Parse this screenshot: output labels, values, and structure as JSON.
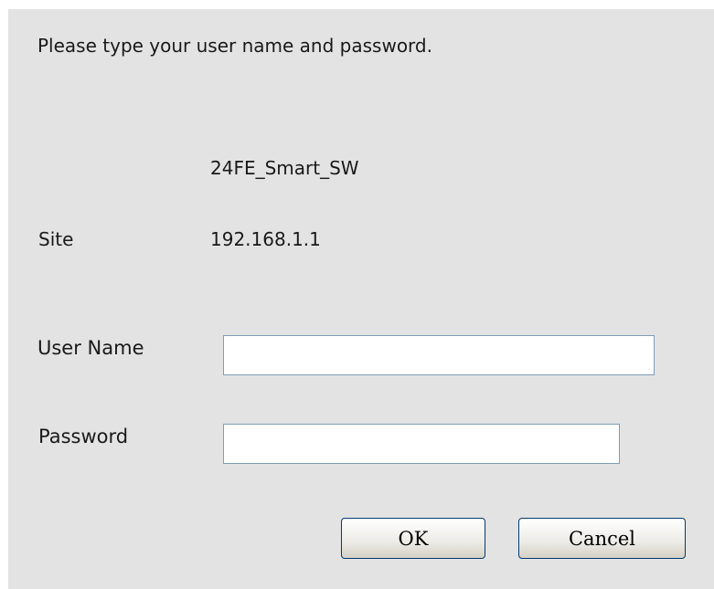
{
  "dialog": {
    "prompt": "Please type your user name and password.",
    "realm": "24FE_Smart_SW",
    "site_label": "Site",
    "site_value": "192.168.1.1",
    "user_name_label": "User Name",
    "user_name_value": "",
    "password_label": "Password",
    "password_value": "",
    "ok_label": "OK",
    "cancel_label": "Cancel"
  }
}
